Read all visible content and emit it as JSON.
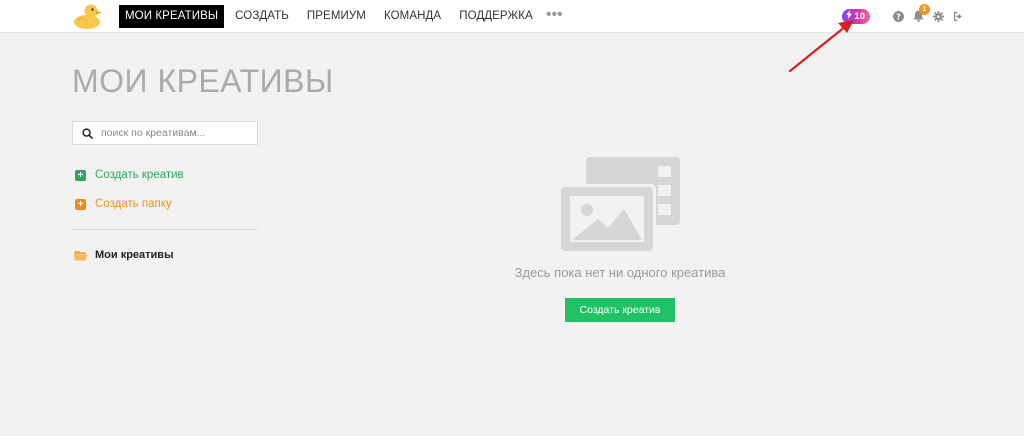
{
  "nav": {
    "items": [
      {
        "label": "МОИ КРЕАТИВЫ",
        "active": true
      },
      {
        "label": "СОЗДАТЬ",
        "active": false
      },
      {
        "label": "ПРЕМИУМ",
        "active": false
      },
      {
        "label": "КОМАНДА",
        "active": false
      },
      {
        "label": "ПОДДЕРЖКА",
        "active": false
      }
    ],
    "more": "•••"
  },
  "toolbar": {
    "credits": "10",
    "notifications_count": "1",
    "icons": [
      "bolt-icon",
      "help-icon",
      "bell-icon",
      "gear-icon",
      "logout-icon"
    ]
  },
  "page": {
    "title": "МОИ КРЕАТИВЫ"
  },
  "sidebar": {
    "search_placeholder": "поиск по креативам...",
    "create_creative": "Создать креатив",
    "create_folder": "Создать папку",
    "folder_name": "Мои креативы"
  },
  "empty_state": {
    "message": "Здесь пока нет ни одного креатива",
    "button": "Создать креатив"
  },
  "colors": {
    "accent_green": "#21c266",
    "link_green": "#2ca65a",
    "orange": "#f08c1e",
    "annotation_red": "#d9201f"
  }
}
